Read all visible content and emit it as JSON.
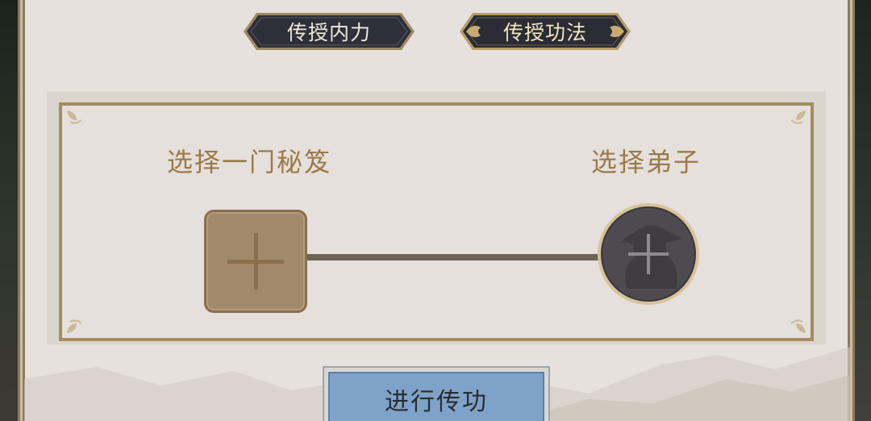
{
  "tabs": [
    {
      "label": "传授内力",
      "active": false
    },
    {
      "label": "传授功法",
      "active": true
    }
  ],
  "panel": {
    "left_label": "选择一门秘笈",
    "right_label": "选择弟子"
  },
  "action_button": {
    "label": "进行传功"
  },
  "colors": {
    "panel_bg": "#e6e1dd",
    "frame": "#a48b62",
    "label_gold": "#9b7a47",
    "button_blue": "#7fa2c8",
    "tab_dark": "#2d2e37"
  },
  "icons": {
    "book_slot": "plus-icon",
    "disciple_slot": "plus-icon"
  }
}
